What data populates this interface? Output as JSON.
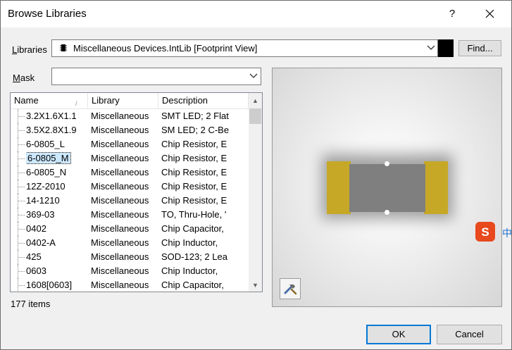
{
  "window": {
    "title": "Browse Libraries",
    "help_label": "?"
  },
  "libraries": {
    "label_pre": "",
    "label_ul": "L",
    "label_post": "ibraries",
    "value": "Miscellaneous Devices.IntLib [Footprint View]",
    "find_label": "Find..."
  },
  "mask": {
    "label_ul": "M",
    "label_post": "ask",
    "value": ""
  },
  "list": {
    "columns": [
      "Name",
      "Library",
      "Description"
    ],
    "rows": [
      {
        "name": "3.2X1.6X1.1",
        "library": "Miscellaneous",
        "description": "SMT LED; 2 Flat"
      },
      {
        "name": "3.5X2.8X1.9",
        "library": "Miscellaneous",
        "description": "SM LED; 2 C-Be"
      },
      {
        "name": "6-0805_L",
        "library": "Miscellaneous",
        "description": "Chip Resistor, E"
      },
      {
        "name": "6-0805_M",
        "library": "Miscellaneous",
        "description": "Chip Resistor, E"
      },
      {
        "name": "6-0805_N",
        "library": "Miscellaneous",
        "description": "Chip Resistor, E"
      },
      {
        "name": "12Z-2010",
        "library": "Miscellaneous",
        "description": "Chip Resistor, E"
      },
      {
        "name": "14-1210",
        "library": "Miscellaneous",
        "description": "Chip Resistor, E"
      },
      {
        "name": "369-03",
        "library": "Miscellaneous",
        "description": "TO, Thru-Hole, '"
      },
      {
        "name": "0402",
        "library": "Miscellaneous",
        "description": "Chip Capacitor,"
      },
      {
        "name": "0402-A",
        "library": "Miscellaneous",
        "description": "Chip Inductor,"
      },
      {
        "name": "425",
        "library": "Miscellaneous",
        "description": "SOD-123; 2 Lea"
      },
      {
        "name": "0603",
        "library": "Miscellaneous",
        "description": "Chip Inductor,"
      },
      {
        "name": "1608[0603]",
        "library": "Miscellaneous",
        "description": "Chip Capacitor,"
      }
    ],
    "selected_index": 3,
    "count_text": "177 items"
  },
  "buttons": {
    "ok": "OK",
    "cancel": "Cancel"
  },
  "overlay": {
    "ime_text": "中"
  },
  "colors": {
    "pad": "#c6a826",
    "body": "#7f7f7f",
    "accent": "#0078d7"
  }
}
